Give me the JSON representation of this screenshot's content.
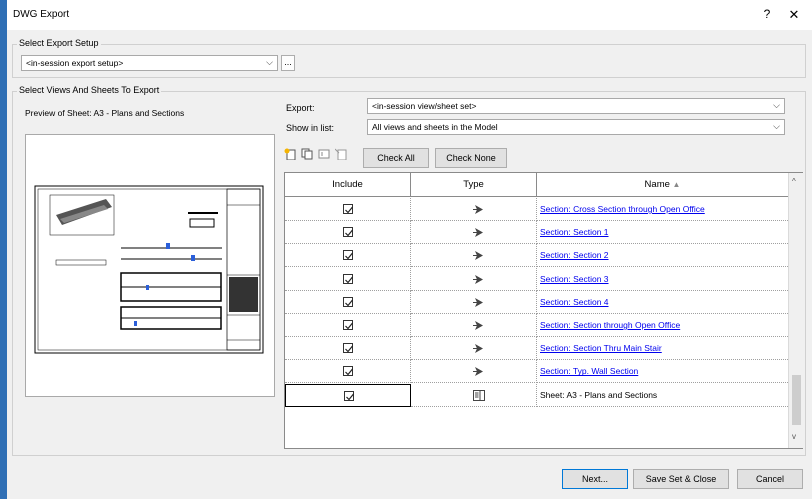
{
  "window": {
    "title": "DWG Export",
    "help_label": "?",
    "close_label": "✕"
  },
  "export_setup": {
    "group_label": "Select Export Setup",
    "selected": "<in-session export setup>",
    "more_label": "..."
  },
  "views": {
    "group_label": "Select Views And Sheets To Export",
    "preview_label": "Preview of Sheet: A3 - Plans and Sections",
    "export_label": "Export:",
    "export_value": "<in-session view/sheet set>",
    "show_label": "Show in list:",
    "show_value": "All views and sheets in the Model",
    "check_all": "Check All",
    "check_none": "Check None"
  },
  "table": {
    "col_include": "Include",
    "col_type": "Type",
    "col_name": "Name",
    "rows": [
      {
        "name": "Section: Cross Section through Open Office",
        "type": "section",
        "checked": true
      },
      {
        "name": "Section: Section 1",
        "type": "section",
        "checked": true
      },
      {
        "name": "Section: Section 2",
        "type": "section",
        "checked": true
      },
      {
        "name": "Section: Section 3",
        "type": "section",
        "checked": true
      },
      {
        "name": "Section: Section 4",
        "type": "section",
        "checked": true
      },
      {
        "name": "Section: Section through Open Office",
        "type": "section",
        "checked": true
      },
      {
        "name": "Section: Section Thru Main Stair",
        "type": "section",
        "checked": true
      },
      {
        "name": "Section: Typ. Wall Section",
        "type": "section",
        "checked": true
      },
      {
        "name": "Sheet: A3 - Plans and Sections",
        "type": "sheet",
        "checked": true
      }
    ]
  },
  "buttons": {
    "next": "Next...",
    "save_close": "Save Set & Close",
    "cancel": "Cancel"
  },
  "colors": {
    "link": "#0000ee",
    "background": "#2f6fb5"
  }
}
